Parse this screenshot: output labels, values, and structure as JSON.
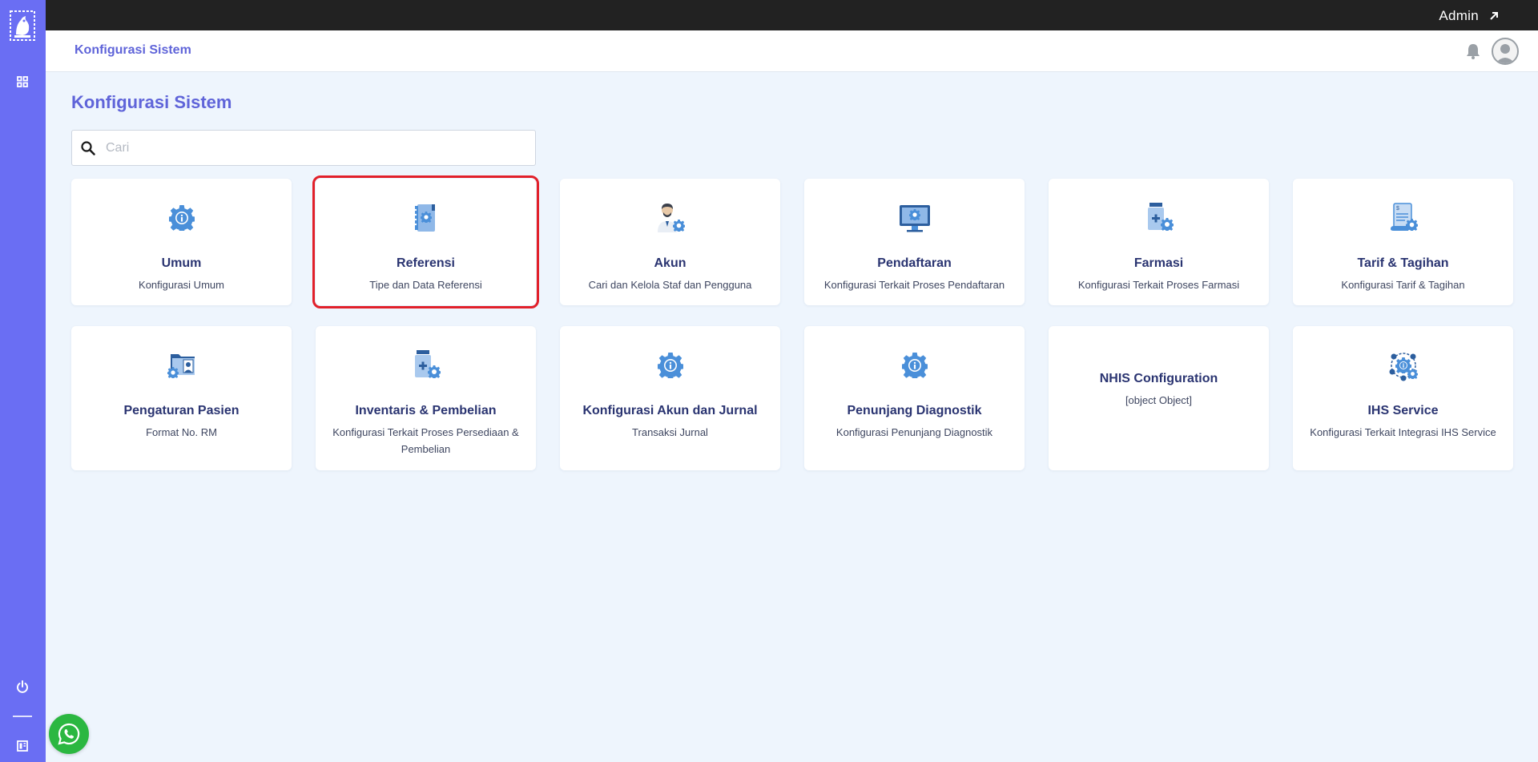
{
  "topbar": {
    "user_label": "Admin"
  },
  "header": {
    "breadcrumb": "Konfigurasi Sistem"
  },
  "main": {
    "title": "Konfigurasi Sistem",
    "search": {
      "placeholder": "Cari",
      "value": ""
    }
  },
  "cards": [
    {
      "title": "Umum",
      "desc": "Konfigurasi Umum",
      "icon": "gear-info-icon",
      "selected": false
    },
    {
      "title": "Referensi",
      "desc": "Tipe dan Data Referensi",
      "icon": "book-gear-icon",
      "selected": true
    },
    {
      "title": "Akun",
      "desc": "Cari dan Kelola Staf dan Pengguna",
      "icon": "user-gear-icon",
      "selected": false
    },
    {
      "title": "Pendaftaran",
      "desc": "Konfigurasi Terkait Proses Pendaftaran",
      "icon": "monitor-gear-icon",
      "selected": false
    },
    {
      "title": "Farmasi",
      "desc": "Konfigurasi Terkait Proses Farmasi",
      "icon": "medicine-gear-icon",
      "selected": false
    },
    {
      "title": "Tarif & Tagihan",
      "desc": "Konfigurasi Tarif & Tagihan",
      "icon": "invoice-gear-icon",
      "selected": false
    },
    {
      "title": "Pengaturan Pasien",
      "desc": "Format No. RM",
      "icon": "patient-folder-icon",
      "selected": false
    },
    {
      "title": "Inventaris & Pembelian",
      "desc": "Konfigurasi Terkait Proses Persediaan & Pembelian",
      "icon": "medicine-gear-icon",
      "selected": false
    },
    {
      "title": "Konfigurasi Akun dan Jurnal",
      "desc": "Transaksi Jurnal",
      "icon": "gear-info-icon",
      "selected": false
    },
    {
      "title": "Penunjang Diagnostik",
      "desc": "Konfigurasi Penunjang Diagnostik",
      "icon": "gear-info-icon",
      "selected": false
    },
    {
      "title": "NHIS Configuration",
      "desc": "[object Object]",
      "icon": "",
      "selected": false
    },
    {
      "title": "IHS Service",
      "desc": "Konfigurasi Terkait Integrasi IHS Service",
      "icon": "network-gear-icon",
      "selected": false
    }
  ],
  "colors": {
    "sidebar": "#6a6ef3",
    "accent": "#5f64d9",
    "card_title": "#2a3471",
    "icon_blue": "#4a90e2",
    "selected_outline": "#e2202a",
    "whatsapp": "#2bb741"
  }
}
